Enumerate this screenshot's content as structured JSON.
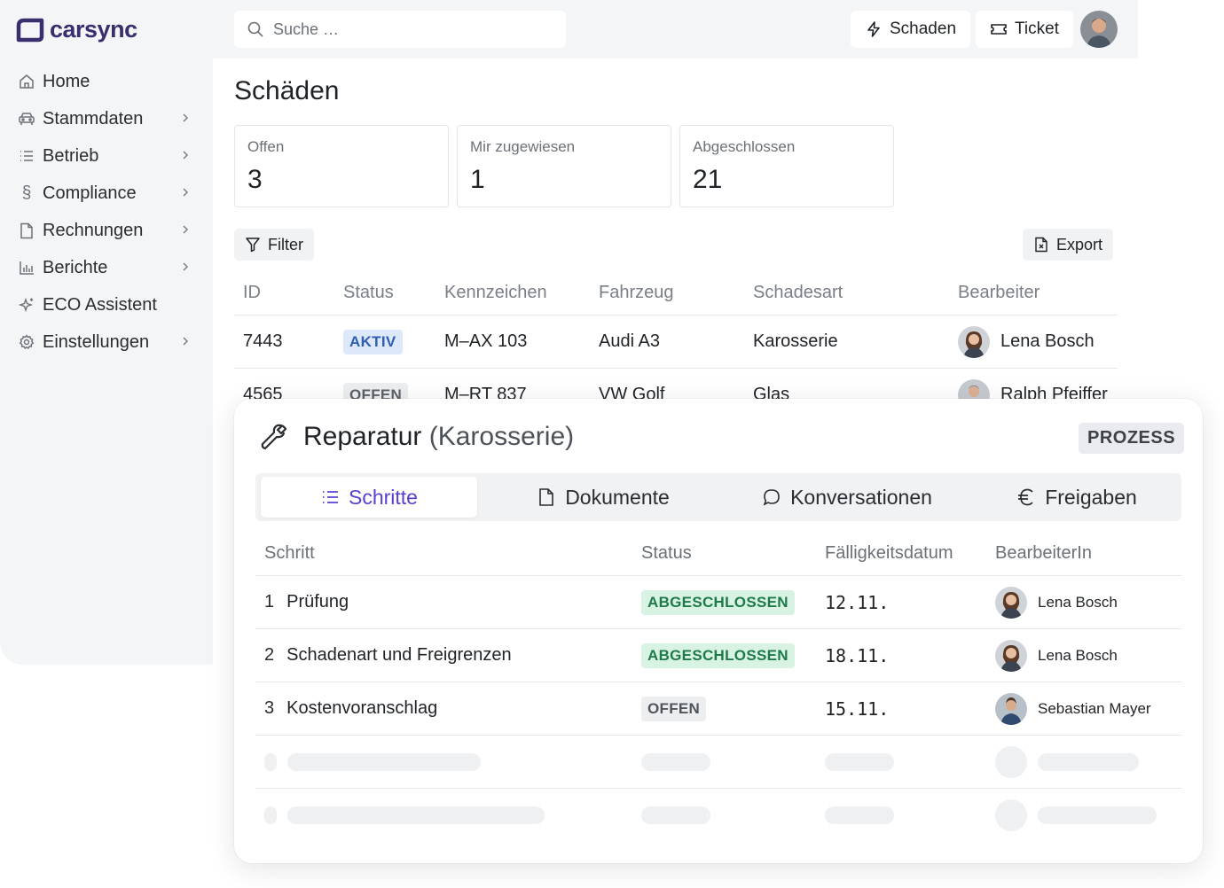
{
  "app": {
    "brand": "carsync",
    "colors": {
      "accent": "#5a3fd1",
      "brand": "#3a2f6e"
    }
  },
  "sidebar": {
    "items": [
      {
        "label": "Home",
        "icon": "home-icon",
        "has_children": false
      },
      {
        "label": "Stammdaten",
        "icon": "car-icon",
        "has_children": true
      },
      {
        "label": "Betrieb",
        "icon": "list-icon",
        "has_children": true
      },
      {
        "label": "Compliance",
        "icon": "paragraph-icon",
        "has_children": true
      },
      {
        "label": "Rechnungen",
        "icon": "file-icon",
        "has_children": true
      },
      {
        "label": "Berichte",
        "icon": "bar-chart-icon",
        "has_children": true
      },
      {
        "label": "ECO Assistent",
        "icon": "sparkles-icon",
        "has_children": false
      },
      {
        "label": "Einstellungen",
        "icon": "gear-icon",
        "has_children": true
      }
    ]
  },
  "topbar": {
    "search_placeholder": "Suche …",
    "schaden_label": "Schaden",
    "ticket_label": "Ticket"
  },
  "page": {
    "title": "Schäden",
    "stats": [
      {
        "label": "Offen",
        "value": "3"
      },
      {
        "label": "Mir zugewiesen",
        "value": "1"
      },
      {
        "label": "Abgeschlossen",
        "value": "21"
      }
    ],
    "filter_label": "Filter",
    "export_label": "Export",
    "table": {
      "headers": [
        "ID",
        "Status",
        "Kennzeichen",
        "Fahrzeug",
        "Schadesart",
        "Bearbeiter"
      ],
      "rows": [
        {
          "id": "7443",
          "status": "AKTIV",
          "kennzeichen": "M–AX 103",
          "fahrzeug": "Audi A3",
          "schadensart": "Karosserie",
          "bearbeiter": "Lena Bosch"
        },
        {
          "id": "4565",
          "status": "OFFEN",
          "kennzeichen": "M–RT 837",
          "fahrzeug": "VW Golf",
          "schadensart": "Glas",
          "bearbeiter": "Ralph Pfeiffer"
        }
      ]
    }
  },
  "panel": {
    "title": "Reparatur",
    "subtitle": "(Karosserie)",
    "badge": "PROZESS",
    "tabs": [
      {
        "label": "Schritte",
        "icon": "list-icon",
        "active": true
      },
      {
        "label": "Dokumente",
        "icon": "file-icon",
        "active": false
      },
      {
        "label": "Konversationen",
        "icon": "chat-bubble-icon",
        "active": false
      },
      {
        "label": "Freigaben",
        "icon": "euro-icon",
        "active": false
      }
    ],
    "table": {
      "headers": [
        "Schritt",
        "Status",
        "Fälligkeitsdatum",
        "BearbeiterIn"
      ],
      "rows": [
        {
          "num": "1",
          "step": "Prüfung",
          "status": "ABGESCHLOSSEN",
          "due": "12.11.",
          "assignee": "Lena Bosch"
        },
        {
          "num": "2",
          "step": "Schadenart und Freigrenzen",
          "status": "ABGESCHLOSSEN",
          "due": "18.11.",
          "assignee": "Lena Bosch"
        },
        {
          "num": "3",
          "step": "Kostenvoranschlag",
          "status": "OFFEN",
          "due": "15.11.",
          "assignee": "Sebastian Mayer"
        }
      ]
    }
  }
}
